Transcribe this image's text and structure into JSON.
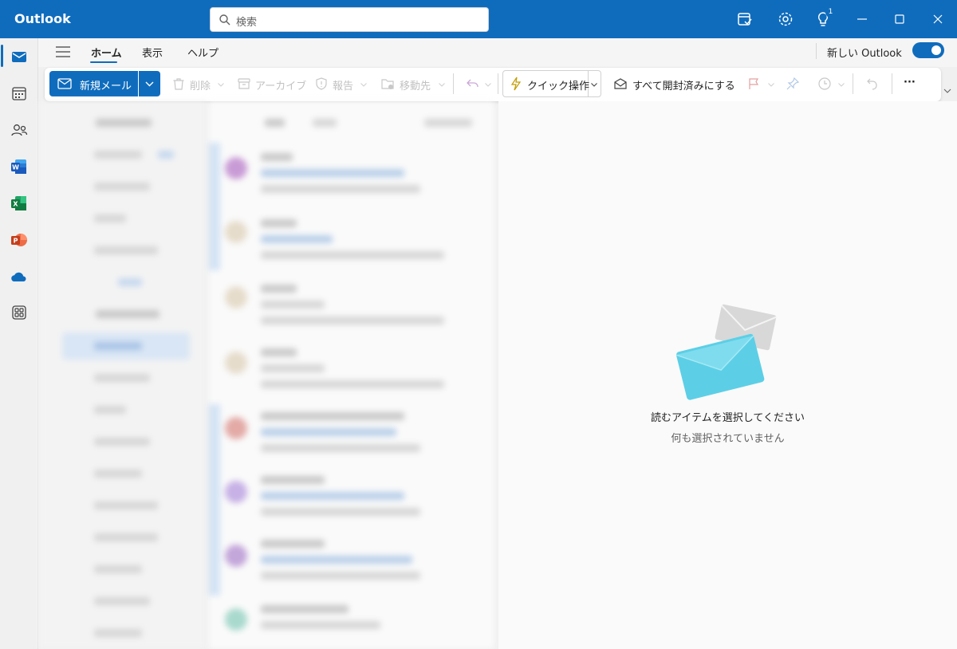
{
  "titlebar": {
    "app_title": "Outlook",
    "search_placeholder": "検索",
    "notification_count": "1"
  },
  "ribbon": {
    "tabs": [
      {
        "label": "ホーム"
      },
      {
        "label": "表示"
      },
      {
        "label": "ヘルプ"
      }
    ],
    "new_outlook_label": "新しい Outlook",
    "new_outlook_enabled": true
  },
  "commands": {
    "new_mail": "新規メール",
    "delete": "削除",
    "archive": "アーカイブ",
    "report": "報告",
    "move": "移動先",
    "quick_steps": "クイック操作",
    "mark_all_read": "すべて開封済みにする",
    "more": "···"
  },
  "rail": {
    "items": [
      "mail-icon",
      "calendar-icon",
      "people-icon",
      "word-icon",
      "excel-icon",
      "powerpoint-icon",
      "onedrive-icon",
      "apps-icon"
    ]
  },
  "reading_pane": {
    "empty_title": "読むアイテムを選択してください",
    "empty_subtitle": "何も選択されていません"
  },
  "colors": {
    "brand": "#0f6cbd",
    "title_bar": "#0f6cbd"
  }
}
